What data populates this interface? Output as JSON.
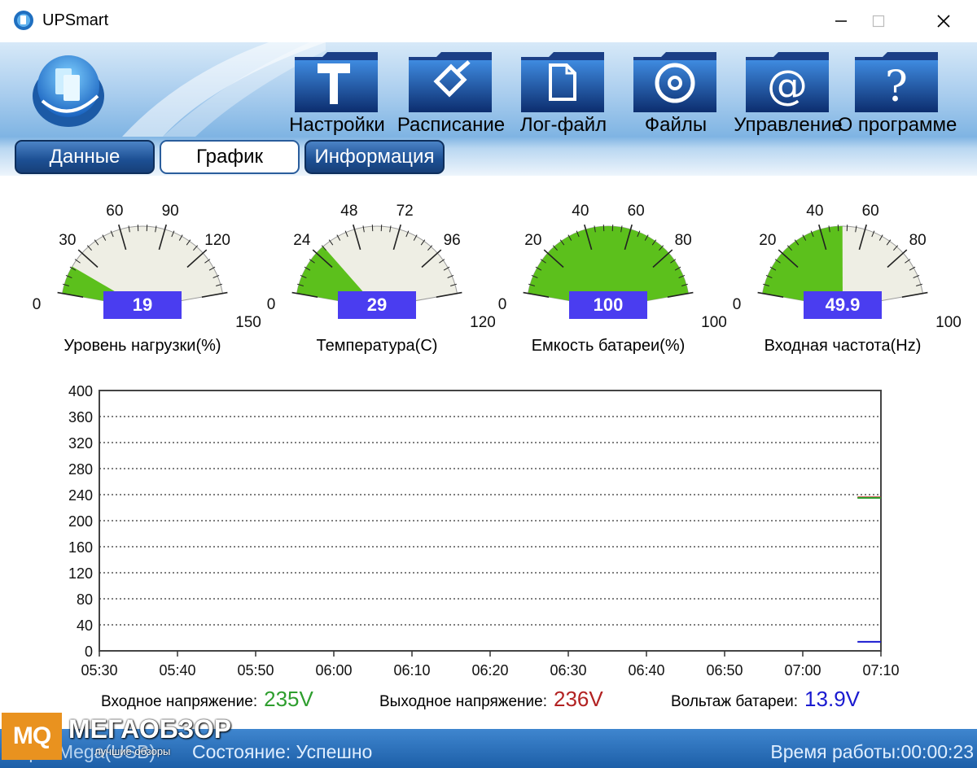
{
  "window": {
    "title": "UPSmart",
    "icon": "app-logo-icon",
    "controls": [
      "minimize-icon",
      "maximize-icon",
      "close-icon"
    ]
  },
  "toolbar": {
    "buttons": [
      {
        "label": "Настройки",
        "icon": "hammer-icon"
      },
      {
        "label": "Расписание",
        "icon": "pencil-icon"
      },
      {
        "label": "Лог-файл",
        "icon": "document-icon"
      },
      {
        "label": "Файлы",
        "icon": "disc-icon"
      },
      {
        "label": "Управление",
        "icon": "at-icon"
      },
      {
        "label": "О программе",
        "icon": "question-icon"
      }
    ]
  },
  "tabs": [
    {
      "label": "Данные",
      "active": false
    },
    {
      "label": "График",
      "active": true
    },
    {
      "label": "Информация",
      "active": false
    }
  ],
  "gauges": [
    {
      "label": "Уровень нагрузки(%)",
      "value": "19",
      "numeric": 19,
      "min": 0,
      "max": 150,
      "ticks": [
        "0",
        "30",
        "60",
        "90",
        "120",
        "150"
      ]
    },
    {
      "label": "Температура(C)",
      "value": "29",
      "numeric": 29,
      "min": 0,
      "max": 120,
      "ticks": [
        "0",
        "24",
        "48",
        "72",
        "96",
        "120"
      ]
    },
    {
      "label": "Емкость батареи(%)",
      "value": "100",
      "numeric": 100,
      "min": 0,
      "max": 100,
      "ticks": [
        "0",
        "20",
        "40",
        "60",
        "80",
        "100"
      ]
    },
    {
      "label": "Входная частота(Hz)",
      "value": "49.9",
      "numeric": 49.9,
      "min": 0,
      "max": 100,
      "ticks": [
        "0",
        "20",
        "40",
        "60",
        "80",
        "100"
      ]
    }
  ],
  "chart_data": {
    "type": "line",
    "title": "",
    "xlabel": "",
    "ylabel": "",
    "ylim": [
      0,
      400
    ],
    "yticks": [
      "0",
      "40",
      "80",
      "120",
      "160",
      "200",
      "240",
      "280",
      "320",
      "360",
      "400"
    ],
    "xticks": [
      "05:30",
      "05:40",
      "05:50",
      "06:00",
      "06:10",
      "06:20",
      "06:30",
      "06:40",
      "06:50",
      "07:00",
      "07:10"
    ],
    "grid": "dotted horizontal",
    "series": [
      {
        "color": "#c0392b",
        "x": [
          "07:07",
          "07:10"
        ],
        "values": [
          236,
          236
        ]
      },
      {
        "color": "#2e9e2e",
        "x": [
          "07:07",
          "07:10"
        ],
        "values": [
          235,
          235
        ]
      },
      {
        "color": "#1a1ad0",
        "x": [
          "07:07",
          "07:10"
        ],
        "values": [
          13.9,
          13.9
        ]
      }
    ]
  },
  "readouts": {
    "input": {
      "label": "Входное напряжение:",
      "value": "235V",
      "color": "#2e9e2e"
    },
    "output": {
      "label": "Выходное напряжение:",
      "value": "236V",
      "color": "#b22222"
    },
    "battery": {
      "label": "Вольтаж батареи:",
      "value": "13.9V",
      "color": "#1a1ad0"
    }
  },
  "statusbar": {
    "port": "Порт: Mega(USB)",
    "state": "Состояние: Успешно",
    "uptime": "Время работы:00:00:23"
  },
  "watermark": {
    "badge": "MQ",
    "text": "МЕГАОБЗОР",
    "sub": "лучшие обзоры"
  }
}
